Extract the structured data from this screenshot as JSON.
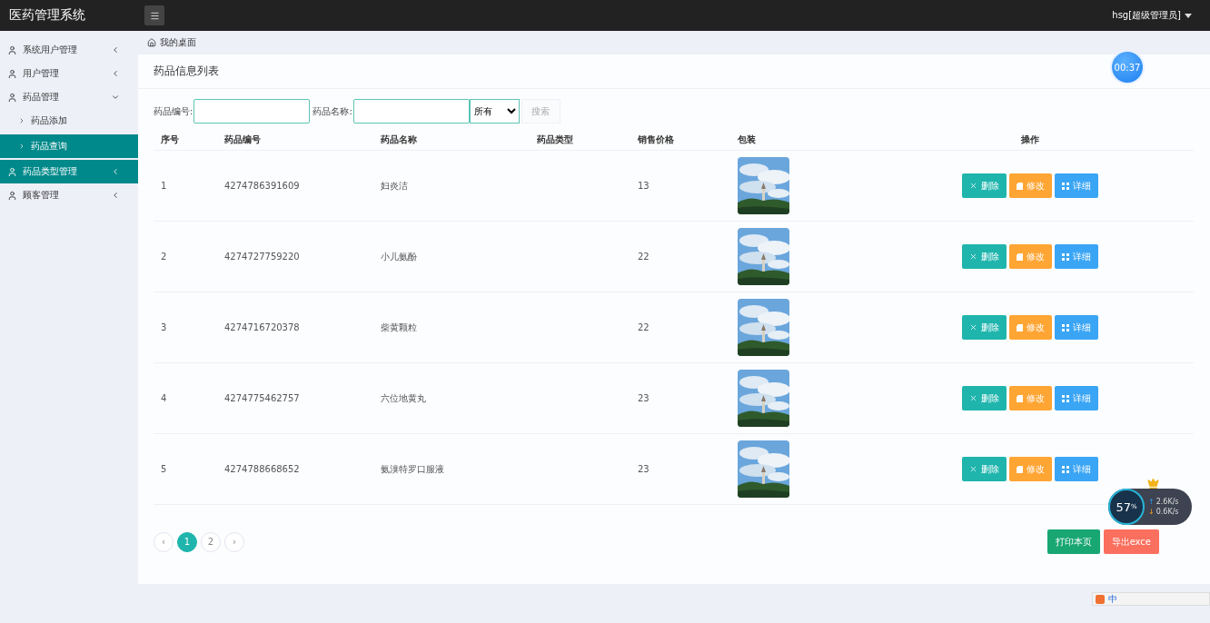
{
  "app_title": "医药管理系统",
  "user_menu": {
    "label": "hsg[超级管理员]"
  },
  "sidebar": {
    "items": [
      {
        "label": "系统用户管理",
        "selected": false,
        "expanded": false
      },
      {
        "label": "用户管理",
        "selected": false,
        "expanded": false
      },
      {
        "label": "药品管理",
        "selected": false,
        "expanded": true,
        "children": [
          {
            "label": "药品添加",
            "selected": false
          },
          {
            "label": "药品查询",
            "selected": true
          }
        ]
      },
      {
        "label": "药品类型管理",
        "selected": true,
        "expanded": false
      },
      {
        "label": "顾客管理",
        "selected": false,
        "expanded": false
      }
    ]
  },
  "breadcrumb": "我的桌面",
  "panel_title": "药品信息列表",
  "timer": "00:37",
  "search": {
    "code_label": "药品编号:",
    "name_label": "药品名称:",
    "type_select": "所有",
    "button": "搜索"
  },
  "table": {
    "columns": [
      "序号",
      "药品编号",
      "药品名称",
      "药品类型",
      "销售价格",
      "包装",
      "操作"
    ],
    "rows": [
      {
        "index": "1",
        "code": "4274786391609",
        "name": "妇炎洁",
        "price": "13",
        "actions": [
          "删除",
          "修改",
          "详细"
        ]
      },
      {
        "index": "2",
        "code": "4274727759220",
        "name": "小儿氨酚",
        "price": "22",
        "actions": [
          "删除",
          "修改",
          "详细"
        ]
      },
      {
        "index": "3",
        "code": "4274716720378",
        "name": "柴黄颗粒",
        "price": "22",
        "actions": [
          "删除",
          "修改",
          "详细"
        ]
      },
      {
        "index": "4",
        "code": "4274775462757",
        "name": "六位地黄丸",
        "price": "23",
        "actions": [
          "删除",
          "修改",
          "详细"
        ]
      },
      {
        "index": "5",
        "code": "4274788668652",
        "name": "氨溴特罗口服液",
        "price": "23",
        "actions": [
          "删除",
          "修改",
          "详细"
        ]
      }
    ]
  },
  "pagination": {
    "prev": "‹",
    "next": "›",
    "pages": [
      {
        "label": "1",
        "selected": true
      },
      {
        "label": "2",
        "selected": false
      }
    ]
  },
  "footer_buttons": [
    "打印本页",
    "导出exce"
  ],
  "speed_widget": {
    "percent": "57",
    "unit": "%",
    "up_arrow": "↑",
    "up": "2.6K/s",
    "down_arrow": "↓",
    "down": "0.6K/s"
  },
  "ime_bar": {
    "label": "中"
  }
}
